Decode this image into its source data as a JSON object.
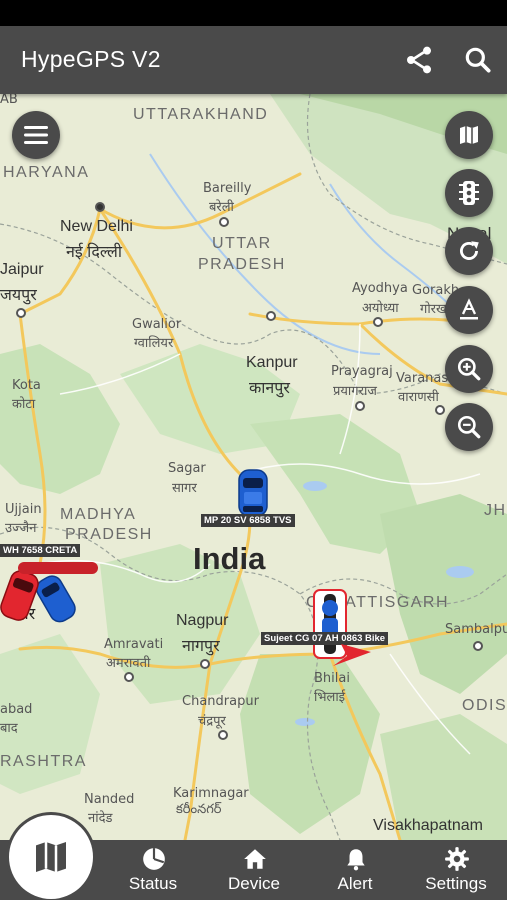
{
  "app": {
    "title": "HypeGPS V2"
  },
  "map": {
    "labels": {
      "uttarakhand": "UTTARAKHAND",
      "haryana": "HARYANA",
      "ab": "AB",
      "new_delhi_en": "New Delhi",
      "new_delhi_hi": "नई दिल्ली",
      "bareilly_en": "Bareilly",
      "bareilly_hi": "बरेली",
      "uttar": "UTTAR",
      "pradesh_up": "PRADESH",
      "nepal": "Nepal",
      "jaipur_en": "Jaipur",
      "jaipur_hi": "जयपुर",
      "ayodhya_en": "Ayodhya",
      "ayodhya_hi": "अयोध्या",
      "gorakh": "Gorakh",
      "gorakh_hi": "गोरख",
      "gwalior_en": "Gwalior",
      "gwalior_hi": "ग्वालियर",
      "kanpur_en": "Kanpur",
      "kanpur_hi": "कानपुर",
      "prayagraj_en": "Prayagraj",
      "prayagraj_hi": "प्रयागराज",
      "varanasi_en": "Varanasi",
      "varanasi_hi": "वाराणसी",
      "kota_en": "Kota",
      "kota_hi": "कोटा",
      "sagar_en": "Sagar",
      "sagar_hi": "सागर",
      "ujjain_en": "Ujjain",
      "ujjain_hi": "उज्जैन",
      "madhya": "MADHYA",
      "pradesh_mp": "PRADESH",
      "jh": "JH",
      "india": "India",
      "indore_partial": "दौर",
      "chhattisgarh": "CHHATTISGARH",
      "nagpur_en": "Nagpur",
      "nagpur_hi": "नागपुर",
      "amravati_en": "Amravati",
      "amravati_hi": "अमरावती",
      "sambalpur": "Sambalpur",
      "bhilai_en": "Bhilai",
      "bhilai_hi": "भिलाई",
      "chandrapur_en": "Chandrapur",
      "chandrapur_hi": "चंद्रपूर",
      "abad": "abad",
      "abad_hi": "बाद",
      "odis": "ODIS",
      "rashtra": "RASHTRA",
      "nanded_en": "Nanded",
      "nanded_hi": "नांदेड",
      "karimnagar_en": "Karimnagar",
      "karimnagar_hi": "కరీంనగర్",
      "visakhapatnam": "Visakhapatnam"
    },
    "vehicles": [
      {
        "label": "MP 20 SV 6858 TVS",
        "type": "car",
        "color": "#1e5fd0"
      },
      {
        "label": "WH 7658 CRETA",
        "type": "car",
        "color": "#e2262f"
      },
      {
        "label": "Sujeet CG 07 AH 0863 Bike",
        "type": "bike",
        "color": "#1e5fd0"
      }
    ]
  },
  "controls": {
    "menu_icon": "hamburger-menu-icon",
    "map_type_icon": "map-icon",
    "traffic_icon": "traffic-light-icon",
    "refresh_icon": "refresh-icon",
    "label_icon": "text-format-icon",
    "zoom_in_icon": "zoom-in-icon",
    "zoom_out_icon": "zoom-out-icon"
  },
  "bottom_nav": {
    "items": [
      {
        "label": "",
        "icon": "map-icon"
      },
      {
        "label": "Status",
        "icon": "pie-chart-icon"
      },
      {
        "label": "Device",
        "icon": "home-icon"
      },
      {
        "label": "Alert",
        "icon": "bell-icon"
      },
      {
        "label": "Settings",
        "icon": "gear-icon"
      }
    ]
  },
  "colors": {
    "toolbar": "#4a4a4a",
    "map_bg": "#e9ecd6",
    "forest": "#c5e2b5",
    "road": "#f7cf6a"
  }
}
